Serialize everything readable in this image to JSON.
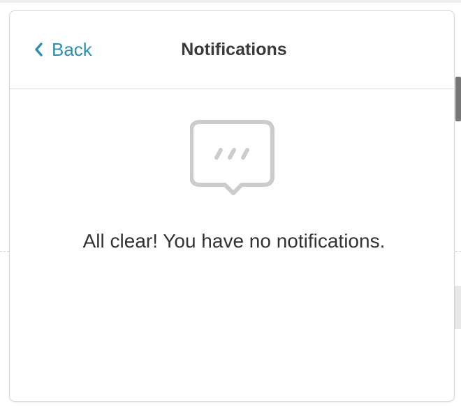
{
  "header": {
    "back_label": "Back",
    "title": "Notifications"
  },
  "empty_state": {
    "icon": "speech-bubble-icon",
    "message": "All clear! You have no notifications."
  },
  "colors": {
    "accent": "#2e8fb0",
    "icon_gray": "#cccccc",
    "text": "#333333"
  }
}
